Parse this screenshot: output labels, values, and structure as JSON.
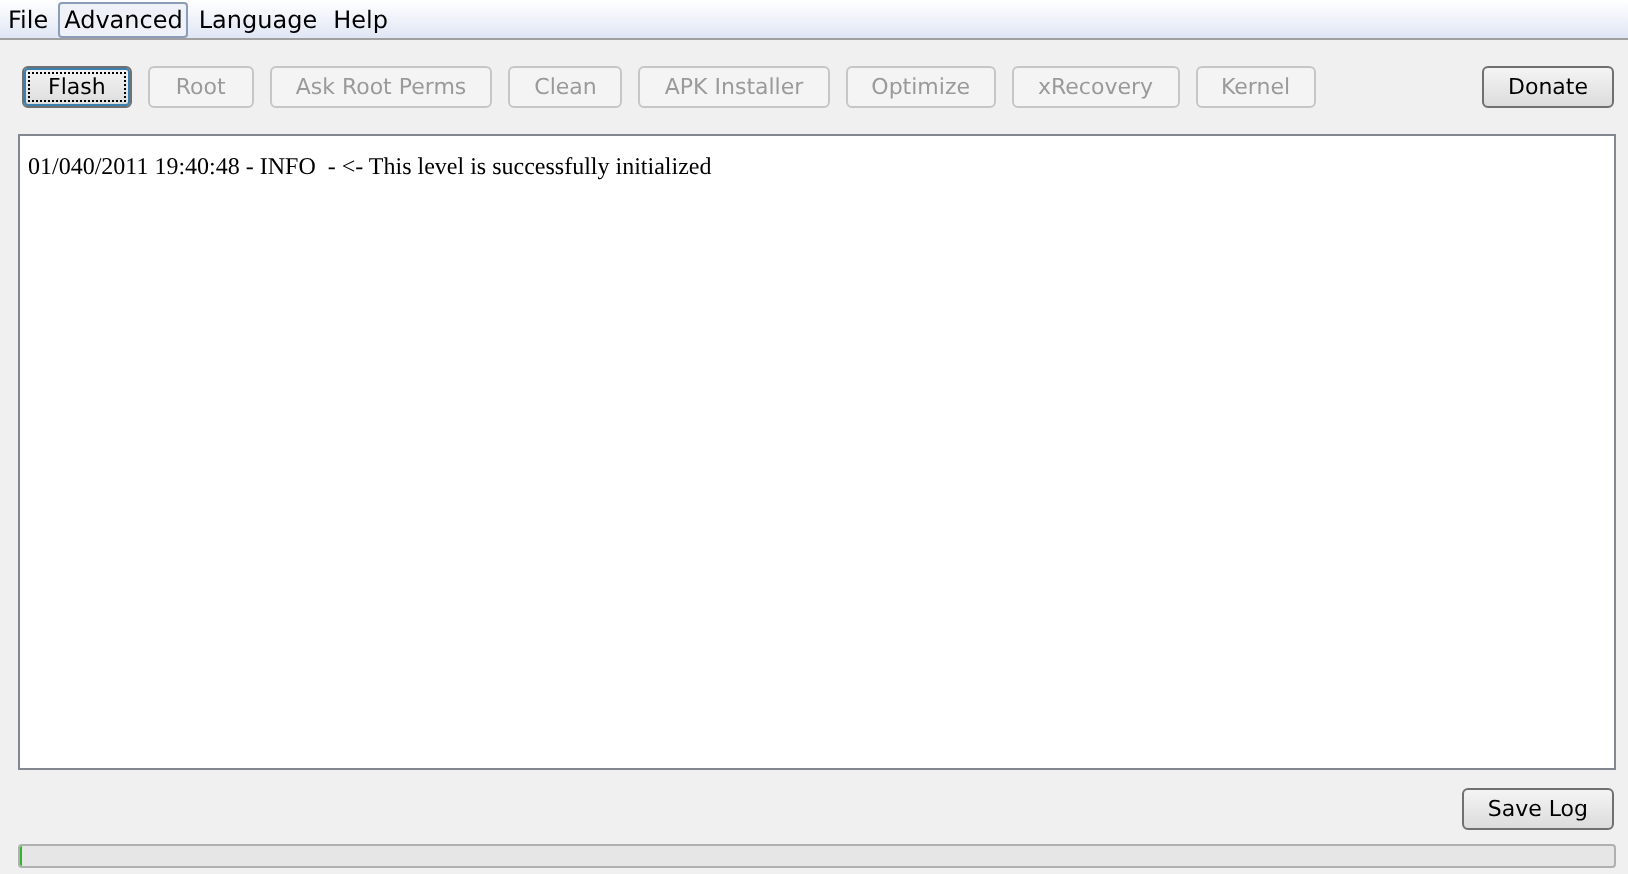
{
  "menu": [
    {
      "label": "File",
      "selected": false
    },
    {
      "label": "Advanced",
      "selected": true
    },
    {
      "label": "Language",
      "selected": false
    },
    {
      "label": "Help",
      "selected": false
    }
  ],
  "toolbar": [
    {
      "label": "Flash",
      "disabled": false,
      "focused": true
    },
    {
      "label": "Root",
      "disabled": true,
      "focused": false
    },
    {
      "label": "Ask Root Perms",
      "disabled": true,
      "focused": false
    },
    {
      "label": "Clean",
      "disabled": true,
      "focused": false
    },
    {
      "label": "APK Installer",
      "disabled": true,
      "focused": false
    },
    {
      "label": "Optimize",
      "disabled": true,
      "focused": false
    },
    {
      "label": "xRecovery",
      "disabled": true,
      "focused": false
    },
    {
      "label": "Kernel",
      "disabled": true,
      "focused": false
    }
  ],
  "donate_button": "Donate",
  "log": [
    "01/040/2011 19:40:48 - INFO  - <- This level is successfully initialized"
  ],
  "save_log_button": "Save Log",
  "progress": {
    "level": 0
  }
}
